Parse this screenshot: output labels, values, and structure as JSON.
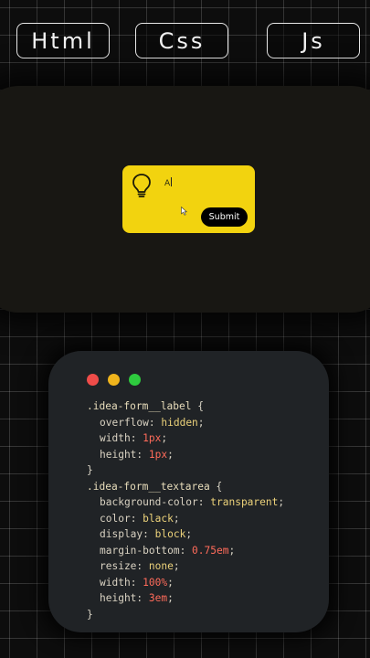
{
  "tabs": {
    "html": "Html",
    "css": "Css",
    "js": "Js"
  },
  "preview": {
    "typed_value": "A",
    "submit_label": "Submit"
  },
  "code_window": {
    "colors": {
      "red": "#ef4c49",
      "yellow": "#f0b41c",
      "green": "#2ecb3e"
    },
    "lines": [
      {
        "sel": ".idea-form__label",
        "open": " {"
      },
      {
        "prop": "overflow",
        "val": "hidden",
        "val_color": "yellow"
      },
      {
        "prop": "width",
        "num": "1px"
      },
      {
        "prop": "height",
        "num": "1px"
      },
      {
        "close": "}"
      },
      {
        "sel": ".idea-form__textarea",
        "open": " {"
      },
      {
        "prop": "background-color",
        "val": "transparent",
        "val_color": "yellow"
      },
      {
        "prop": "color",
        "val": "black",
        "val_color": "yellow"
      },
      {
        "prop": "display",
        "val": "block",
        "val_color": "yellow"
      },
      {
        "prop": "margin-bottom",
        "num": "0.75em"
      },
      {
        "prop": "resize",
        "val": "none",
        "val_color": "yellow"
      },
      {
        "prop": "width",
        "num": "100%"
      },
      {
        "prop": "height",
        "num": "3em"
      },
      {
        "close": "}"
      }
    ]
  },
  "accent_color": "#f2d30f"
}
